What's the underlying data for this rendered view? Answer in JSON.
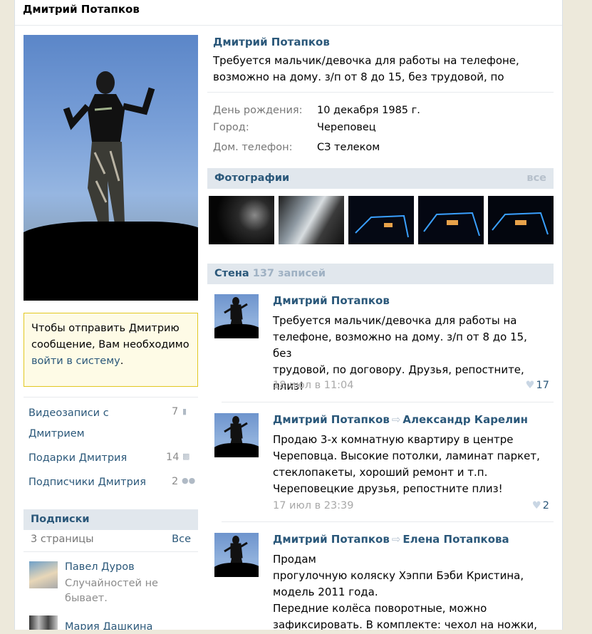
{
  "header": {
    "title": "Дмитрий Потапков"
  },
  "login_box": {
    "text_before": "Чтобы отправить Дмитрию сообщение, Вам необходимо ",
    "link": "войти в систему",
    "text_after": "."
  },
  "side_links": [
    {
      "label_line1": "Видеозаписи с",
      "label_line2": "Дмитрием",
      "count": "7",
      "icon": "video-icon"
    },
    {
      "label_line1": "Подарки Дмитрия",
      "count": "14",
      "icon": "gift-icon"
    },
    {
      "label_line1": "Подписчики Дмитрия",
      "count": "2",
      "icon": "people-icon"
    }
  ],
  "subscriptions": {
    "title": "Подписки",
    "pages_count": "3 страницы",
    "all_label": "Все",
    "people": [
      {
        "name": "Павел Дуров",
        "subtitle": "Случайностей не бывает."
      },
      {
        "name": "Мария Дашкина",
        "subtitle": ""
      }
    ]
  },
  "profile": {
    "name": "Дмитрий Потапков",
    "status": "Требуется мальчик/девочка для работы на телефоне, возможно на дому. з/п от 8 до 15, без трудовой, по договору. Друзья, репостните, плиз!",
    "info": [
      {
        "label": "День рождения:",
        "value": "10 декабря 1985 г."
      },
      {
        "label": "Город:",
        "value": "Череповец"
      },
      {
        "label": "Дом. телефон:",
        "value": "СЗ телеком"
      }
    ]
  },
  "photos": {
    "title": "Фотографии",
    "all_label": "все"
  },
  "wall": {
    "title": "Стена",
    "count": "137 записей",
    "posts": [
      {
        "author": "Дмитрий Потапков",
        "repost_from": "",
        "text": "Требуется мальчик/девочка для работы на\nтелефоне, возможно на дому. з/п от 8 до 15, без\nтрудовой, по договору. Друзья, репостните,\nплиз!",
        "date": "18 июл в 11:04",
        "likes": "17"
      },
      {
        "author": "Дмитрий Потапков",
        "repost_from": "Александр Карелин",
        "text": "Продаю 3-х комнатную квартиру в центре\nЧереповца. Высокие потолки, ламинат паркет,\nстеклопакеты, хороший ремонт и т.п.\nЧереповецкие друзья, репостните плиз!",
        "date": "17 июл в 23:39",
        "likes": "2"
      },
      {
        "author": "Дмитрий Потапков",
        "repost_from": "Елена Потапкова",
        "text": "Продам\nпрогулочную коляску Хэппи Бэби Кристина,\nмодель 2011 года.\nПередние колёса поворотные, можно\nзафиксировать. В комплекте: чехол на ножки,",
        "date": "",
        "likes": ""
      }
    ]
  },
  "colors": {
    "link": "#2b587a",
    "bar": "#e1e7ed",
    "login_bg": "#fefbe6",
    "login_border": "#e2c822"
  }
}
